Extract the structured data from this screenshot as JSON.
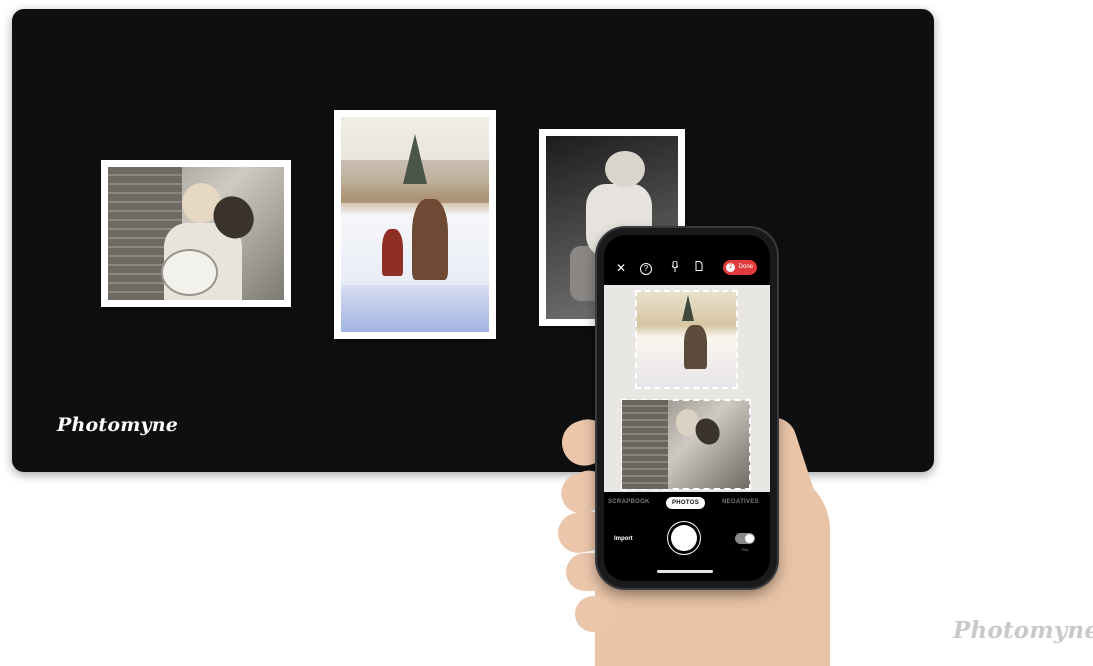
{
  "mat": {
    "logo_text": "Photomyne"
  },
  "watermark": {
    "logo_text": "Photomyne"
  },
  "phone": {
    "topbar": {
      "icons": [
        "close-icon",
        "help-icon",
        "microphone-icon",
        "document-icon"
      ],
      "close_glyph": "✕",
      "help_glyph": "?",
      "mic_glyph": "🎙",
      "doc_glyph": "▯",
      "done_label": "Done",
      "done_count": "2"
    },
    "modes": {
      "scrapbook": "SCRAPBOOK",
      "photos": "PHOTOS",
      "negatives": "NEGATIVES"
    },
    "bottom": {
      "import_label": "Import",
      "toggle_label": "Pro"
    },
    "colors": {
      "accent": "#e23b3b"
    }
  }
}
